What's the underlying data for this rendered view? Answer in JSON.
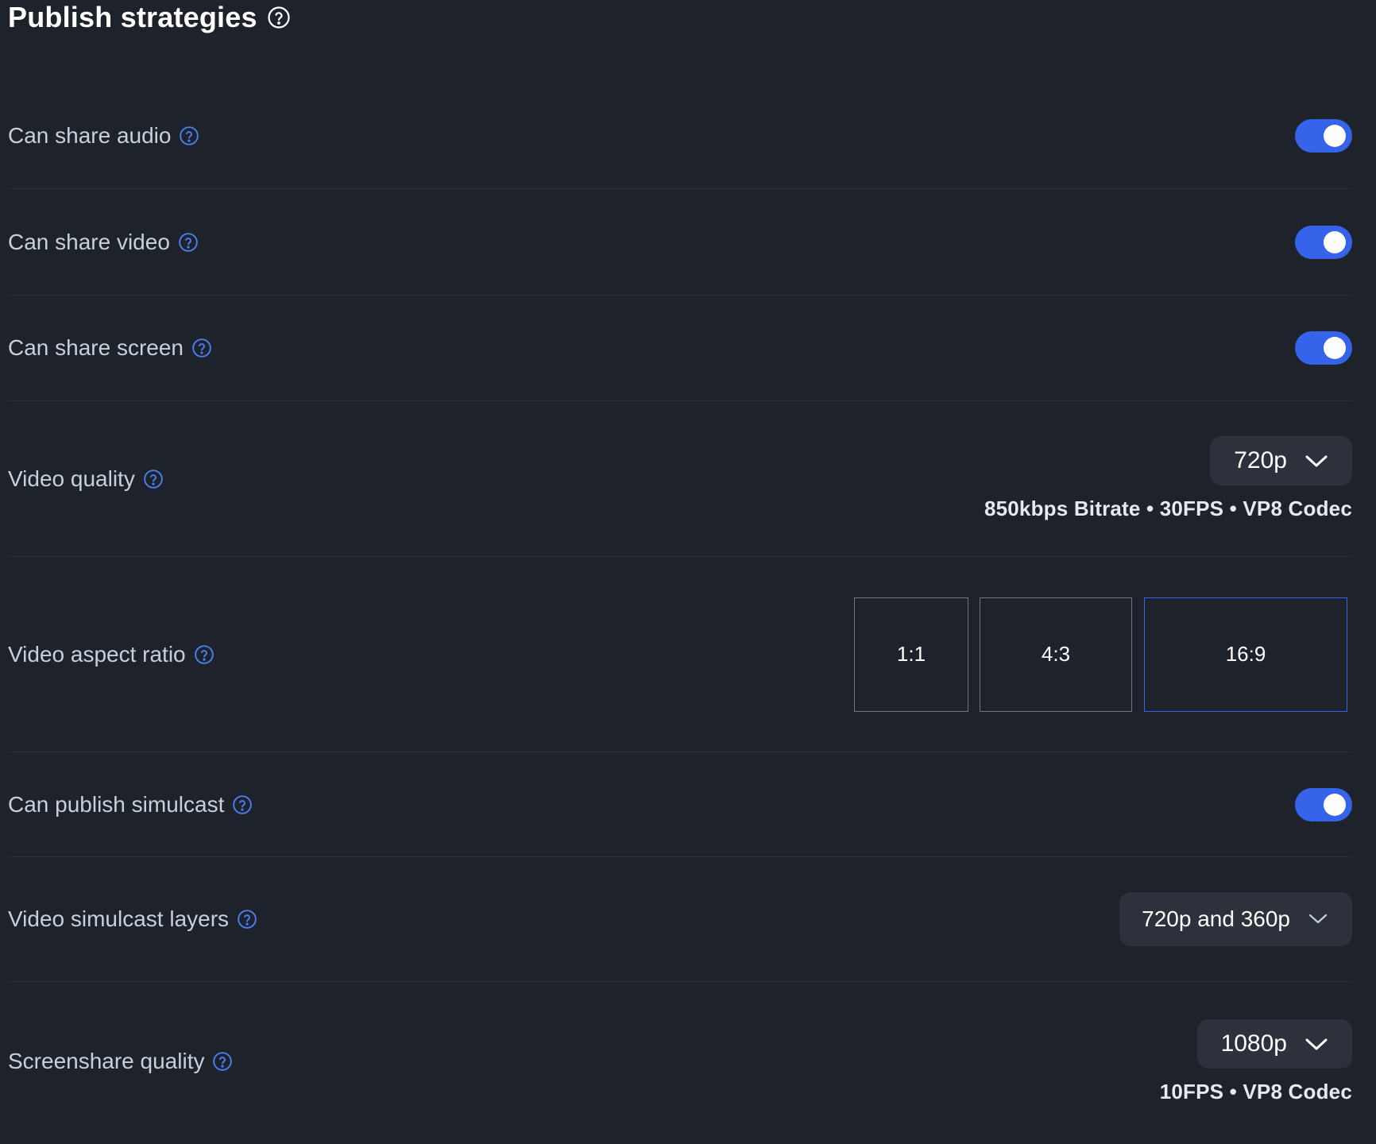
{
  "header": {
    "title": "Publish strategies",
    "help_icon": "question-circle-icon"
  },
  "settings": {
    "share_audio": {
      "label": "Can share audio",
      "enabled": true
    },
    "share_video": {
      "label": "Can share video",
      "enabled": true
    },
    "share_screen": {
      "label": "Can share screen",
      "enabled": true
    },
    "video_quality": {
      "label": "Video quality",
      "value": "720p",
      "details": "850kbps Bitrate • 30FPS • VP8 Codec"
    },
    "video_aspect_ratio": {
      "label": "Video aspect ratio",
      "options": [
        "1:1",
        "4:3",
        "16:9"
      ],
      "selected": "16:9"
    },
    "publish_simulcast": {
      "label": "Can publish simulcast",
      "enabled": true
    },
    "simulcast_layers": {
      "label": "Video simulcast layers",
      "value": "720p and 360p"
    },
    "screenshare_quality": {
      "label": "Screenshare quality",
      "value": "1080p",
      "details": "10FPS • VP8 Codec"
    }
  },
  "colors": {
    "background": "#1e222b",
    "accent": "#3563e9",
    "select_bg": "#2c313b",
    "divider": "#2c313b",
    "label": "#c8d0dc"
  },
  "icons": {
    "help": "question-circle-icon",
    "dropdown": "chevron-down-icon"
  }
}
